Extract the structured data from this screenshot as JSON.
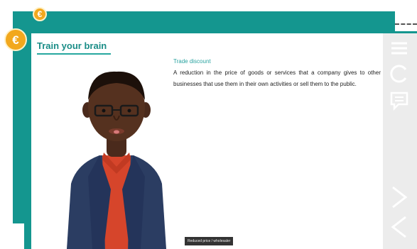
{
  "lesson": {
    "title": "Train your brain",
    "term": "Trade discount",
    "definition": "A reduction in the price of goods or services that a company gives to other businesses that use them in their own activities or sell them to the public.",
    "caption": "Reduced price / wholesaler"
  },
  "coins": {
    "symbol": "€"
  },
  "colors": {
    "teal": "#14968f",
    "coin": "#f2a81d",
    "sidebar": "#ececec"
  },
  "sidebar": {
    "icons": [
      "menu-icon",
      "replay-icon",
      "transcript-icon",
      "next-icon",
      "previous-icon"
    ]
  }
}
